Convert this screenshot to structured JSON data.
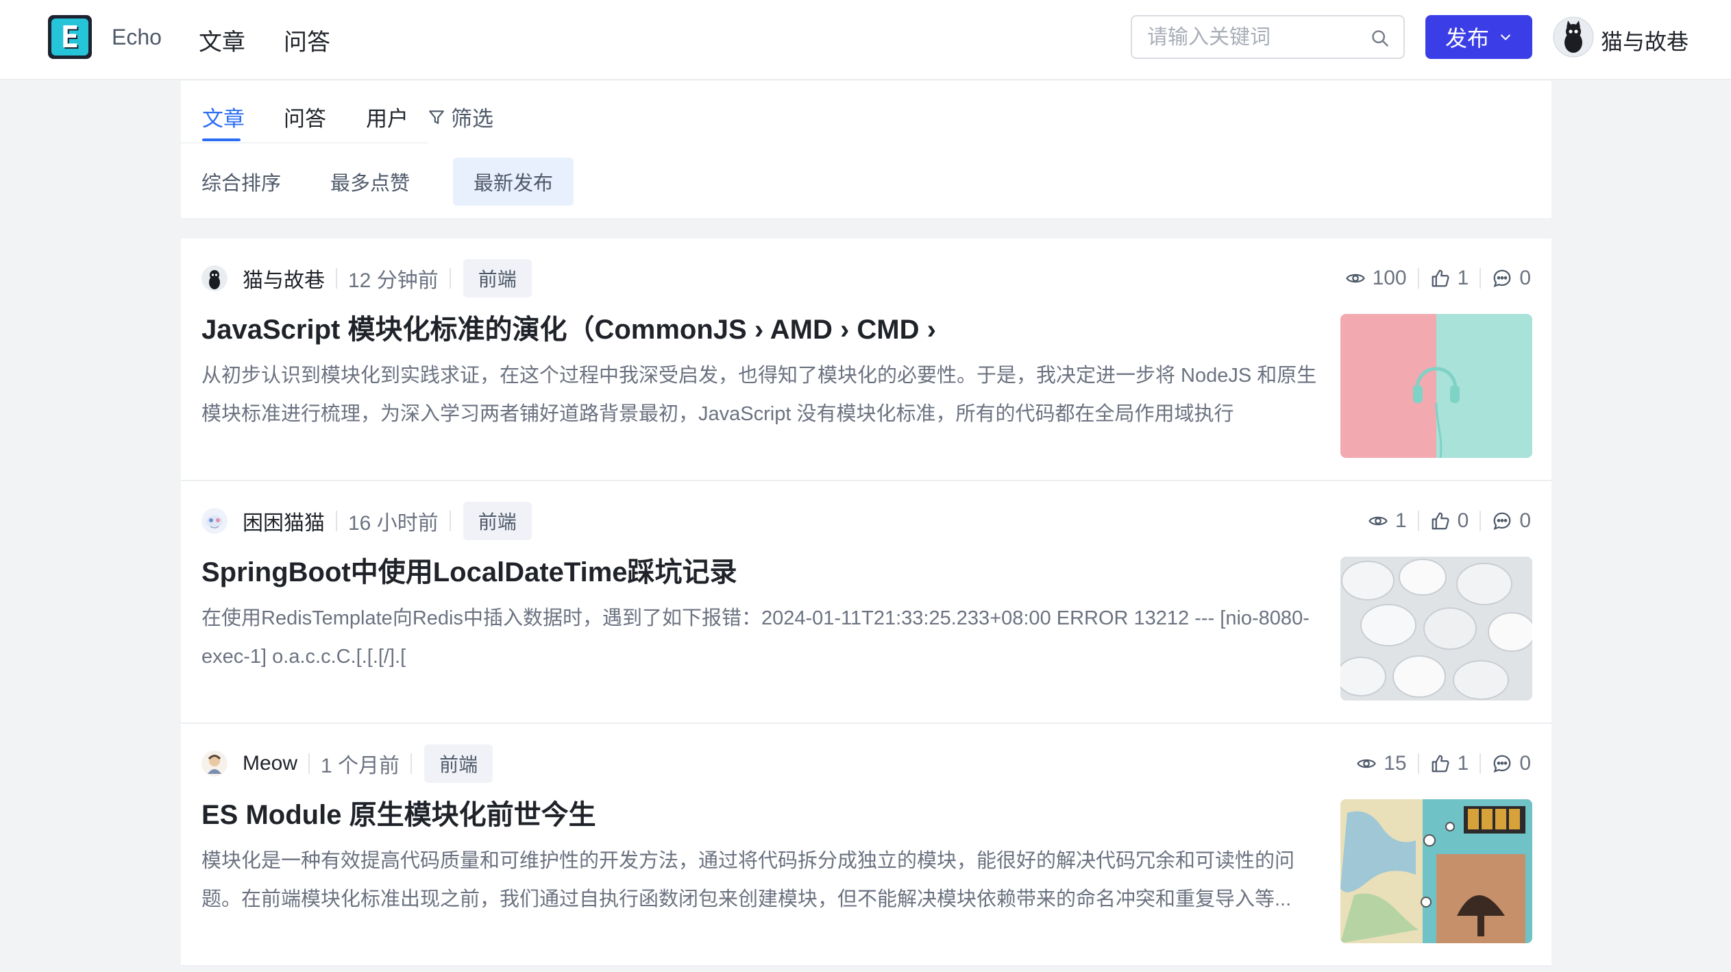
{
  "header": {
    "brand": "Echo",
    "nav": [
      "文章",
      "问答"
    ],
    "search_placeholder": "请输入关键词",
    "publish_label": "发布",
    "user_name": "猫与故巷"
  },
  "filters": {
    "tabs": [
      "文章",
      "问答",
      "用户"
    ],
    "filter_label": "筛选",
    "sort_options": [
      "综合排序",
      "最多点赞",
      "最新发布"
    ],
    "active_sort": "最新发布"
  },
  "articles": [
    {
      "author": "猫与故巷",
      "time": "12 分钟前",
      "tag": "前端",
      "views": "100",
      "likes": "1",
      "comments": "0",
      "title": "JavaScript 模块化标准的演化（CommonJS › AMD › CMD ›",
      "summary": "从初步认识到模块化到实践求证，在这个过程中我深受启发，也得知了模块化的必要性。于是，我决定进一步将 NodeJS 和原生模块标准进行梳理，为深入学习两者铺好道路背景最初，JavaScript 没有模块化标准，所有的代码都在全局作用域执行"
    },
    {
      "author": "困困猫猫",
      "time": "16 小时前",
      "tag": "前端",
      "views": "1",
      "likes": "0",
      "comments": "0",
      "title": "SpringBoot中使用LocalDateTime踩坑记录",
      "summary": "在使用RedisTemplate向Redis中插入数据时，遇到了如下报错：2024-01-11T21:33:25.233+08:00 ERROR 13212 --- [nio-8080-exec-1] o.a.c.c.C.[.[.[/].["
    },
    {
      "author": "Meow",
      "time": "1 个月前",
      "tag": "前端",
      "views": "15",
      "likes": "1",
      "comments": "0",
      "title": "ES Module 原生模块化前世今生",
      "summary": "模块化是一种有效提高代码质量和可维护性的开发方法，通过将代码拆分成独立的模块，能很好的解决代码冗余和可读性的问题。在前端模块化标准出现之前，我们通过自执行函数闭包来创建模块，但不能解决模块依赖带来的命名冲突和重复导入等..."
    }
  ],
  "colors": {
    "accent": "#2a6df4",
    "publish": "#3b3ee6"
  }
}
